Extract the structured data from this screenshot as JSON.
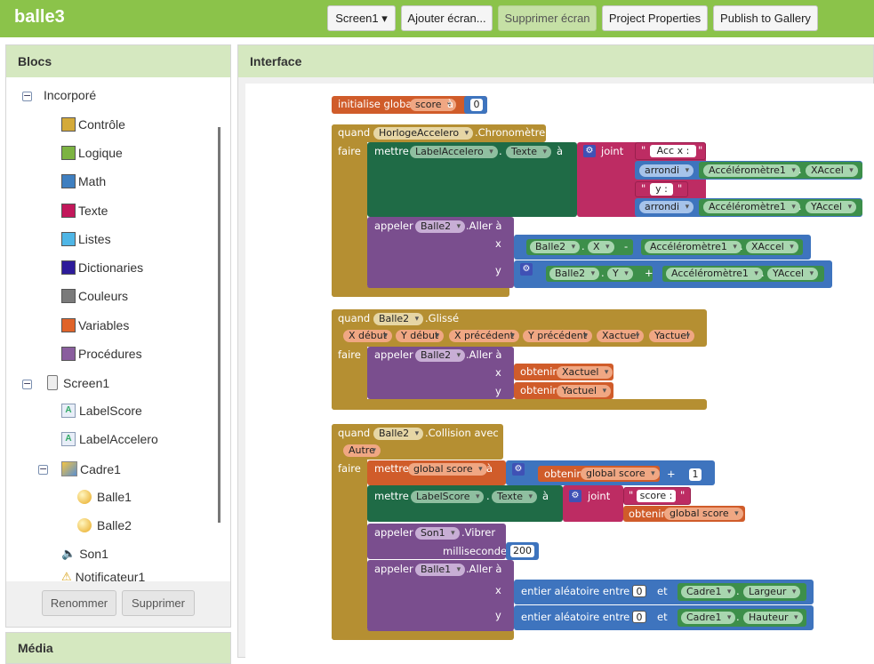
{
  "app": {
    "title": "balle3"
  },
  "toolbar": {
    "screen": "Screen1 ▾",
    "add_screen": "Ajouter écran...",
    "remove_screen": "Supprimer écran",
    "properties": "Project Properties",
    "publish": "Publish to Gallery"
  },
  "blocks_panel": {
    "title": "Blocs",
    "builtin": "Incorporé",
    "categories": [
      {
        "label": "Contrôle",
        "color": "#d4aa3a"
      },
      {
        "label": "Logique",
        "color": "#7cb342"
      },
      {
        "label": "Math",
        "color": "#3f7fc0"
      },
      {
        "label": "Texte",
        "color": "#c2185b"
      },
      {
        "label": "Listes",
        "color": "#4fb6e6"
      },
      {
        "label": "Dictionaries",
        "color": "#2d1b9a"
      },
      {
        "label": "Couleurs",
        "color": "#7a7a7a"
      },
      {
        "label": "Variables",
        "color": "#e0642a"
      },
      {
        "label": "Procédures",
        "color": "#8a5e9e"
      }
    ],
    "components": [
      "Screen1",
      "LabelScore",
      "LabelAccelero",
      "Cadre1",
      "Balle1",
      "Balle2",
      "Son1",
      "Notificateur1"
    ],
    "rename": "Renommer",
    "delete": "Supprimer"
  },
  "media_panel": {
    "title": "Média"
  },
  "interface_panel": {
    "title": "Interface"
  },
  "blocks": {
    "init_global": "initialise global",
    "score_var": "score",
    "a": "à",
    "zero": "0",
    "quand": "quand",
    "faire": "faire",
    "horloge": "HorlogeAccelero",
    "chronometre": ".Chronomètre",
    "mettre": "mettre",
    "label_accelero": "LabelAccelero",
    "dot": ".",
    "texte": "Texte",
    "joint": "joint",
    "acc_x": "Acc x :",
    "arrondi": "arrondi",
    "accelerometre": "Accéléromètre1",
    "xaccel": "XAccel",
    "y_sep": "y :",
    "yaccel": "YAccel",
    "appeler": "appeler",
    "balle2": "Balle2",
    "aller_a": ".Aller à",
    "x": "x",
    "y": "y",
    "xprop": "X",
    "yprop": "Y",
    "minus": "-",
    "plus": "+",
    "glisse": ".Glissé",
    "xdebut": "X début",
    "ydebut": "Y début",
    "xprec": "X précédent",
    "yprec": "Y précédent",
    "xactuel": "Xactuel",
    "yactuel": "Yactuel",
    "obtenir": "obtenir",
    "collision": ".Collision avec",
    "autre": "Autre",
    "global_score": "global score",
    "one": "1",
    "label_score": "LabelScore",
    "score_lbl": "score :",
    "son1": "Son1",
    "vibrer": ".Vibrer",
    "millisecondes": "millisecondes",
    "ms_val": "200",
    "balle1": "Balle1",
    "random": "entier aléatoire entre",
    "et": "et",
    "cadre1": "Cadre1",
    "largeur": "Largeur",
    "hauteur": "Hauteur"
  },
  "colors": {
    "control": "#b58f32",
    "variable": "#d05c2a",
    "component_set": "#1f6b46",
    "component_call": "#7a4e8e",
    "text": "#bd2c63",
    "math": "#3e74be",
    "component_get": "#3d8f4a"
  }
}
